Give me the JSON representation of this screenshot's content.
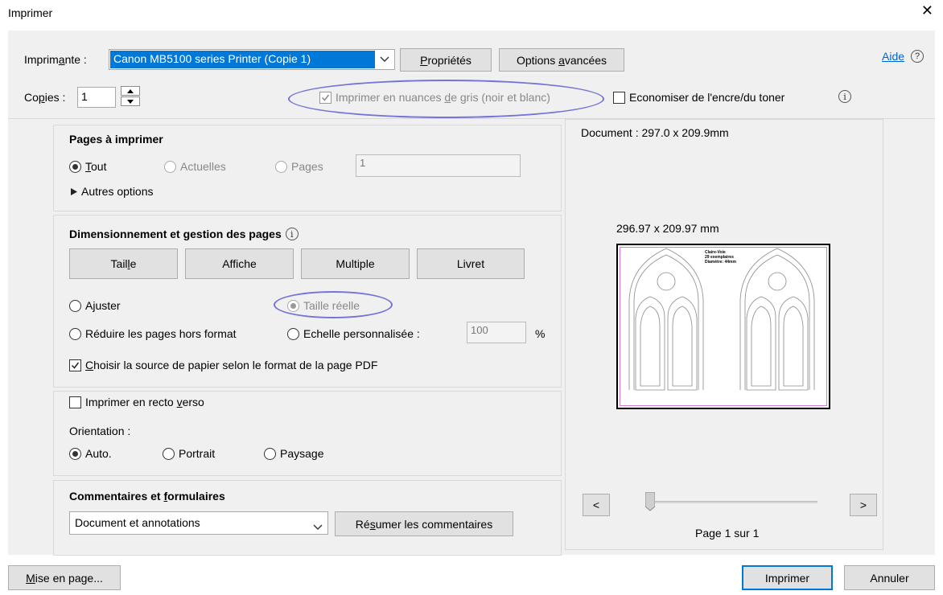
{
  "window": {
    "title": "Imprimer",
    "close_glyph": "✕"
  },
  "printer": {
    "label_before": "Imprim",
    "label_underlined": "a",
    "label_after": "nte :",
    "selected": "Canon MB5100 series Printer (Copie 1)",
    "properties_button": {
      "before": "",
      "underlined": "P",
      "after": "ropriétés"
    },
    "advanced_button": {
      "before": "Options ",
      "underlined": "a",
      "after": "vancées"
    }
  },
  "help": {
    "label": "Aide",
    "icon_glyph": "?"
  },
  "copies": {
    "label_before": "Co",
    "label_underlined": "p",
    "label_after": "ies :",
    "value": "1"
  },
  "grayscale": {
    "label_before": "Imprimer en nuances ",
    "label_underlined": "d",
    "label_after": "e gris (noir et blanc)",
    "checked": true
  },
  "save_ink": {
    "label": "Economiser de l'encre/du toner",
    "checked": false
  },
  "pages_section": {
    "title": "Pages à imprimer",
    "all_before": "",
    "all_underlined": "T",
    "all_after": "out",
    "current": "Actuelles",
    "pages": "Pages",
    "pages_value": "1",
    "more_options": "Autres options",
    "selected": "Tout"
  },
  "sizing_section": {
    "title": "Dimensionnement et gestion des pages",
    "info_glyph": "i",
    "buttons": [
      {
        "before": "Tail",
        "underlined": "l",
        "after": "e"
      },
      {
        "before": "Affiche",
        "underlined": "",
        "after": ""
      },
      {
        "before": "Multiple",
        "underlined": "",
        "after": ""
      },
      {
        "before": "Livret",
        "underlined": "",
        "after": ""
      }
    ],
    "fit_before": "A",
    "fit_underlined": "j",
    "fit_after": "uster",
    "actual_size": "Taille réelle",
    "shrink": "Réduire les pages hors format",
    "custom_scale": "Echelle personnalisée :",
    "scale_value": "100",
    "percent": "%",
    "paper_source_before": "",
    "paper_source_underlined": "C",
    "paper_source_after": "hoisir la source de papier selon le format de la page PDF",
    "paper_source_checked": true
  },
  "duplex_section": {
    "duplex_before": "Imprimer en recto ",
    "duplex_underlined": "v",
    "duplex_after": "erso",
    "duplex_checked": false,
    "orientation_label": "Orientation :",
    "auto": "Auto.",
    "portrait": "Portrait",
    "landscape": "Paysage",
    "selected": "Auto."
  },
  "comments_section": {
    "title_before": "Commentaires et ",
    "title_underlined": "f",
    "title_after": "ormulaires",
    "selected": "Document et annotations",
    "summarize_before": "Ré",
    "summarize_underlined": "s",
    "summarize_after": "umer les commentaires"
  },
  "preview": {
    "document_size": "Document : 297.0 x 209.9mm",
    "page_size": "296.97 x 209.97 mm",
    "thumbnail_text": [
      "Claire-Voie",
      "29 exemplaires",
      "Diamètre: 44mm"
    ],
    "prev_glyph": "<",
    "next_glyph": ">",
    "page_indicator": "Page 1 sur 1",
    "slider_position": 0
  },
  "footer": {
    "page_setup_before": "",
    "page_setup_underlined": "M",
    "page_setup_after": "ise en page...",
    "print_button": "Imprimer",
    "cancel_button": "Annuler"
  },
  "colors": {
    "accent": "#0078d7",
    "annotation_ellipse": "#7373d8",
    "button_face": "#e1e1e1",
    "panel_background": "#f0f0f0"
  }
}
